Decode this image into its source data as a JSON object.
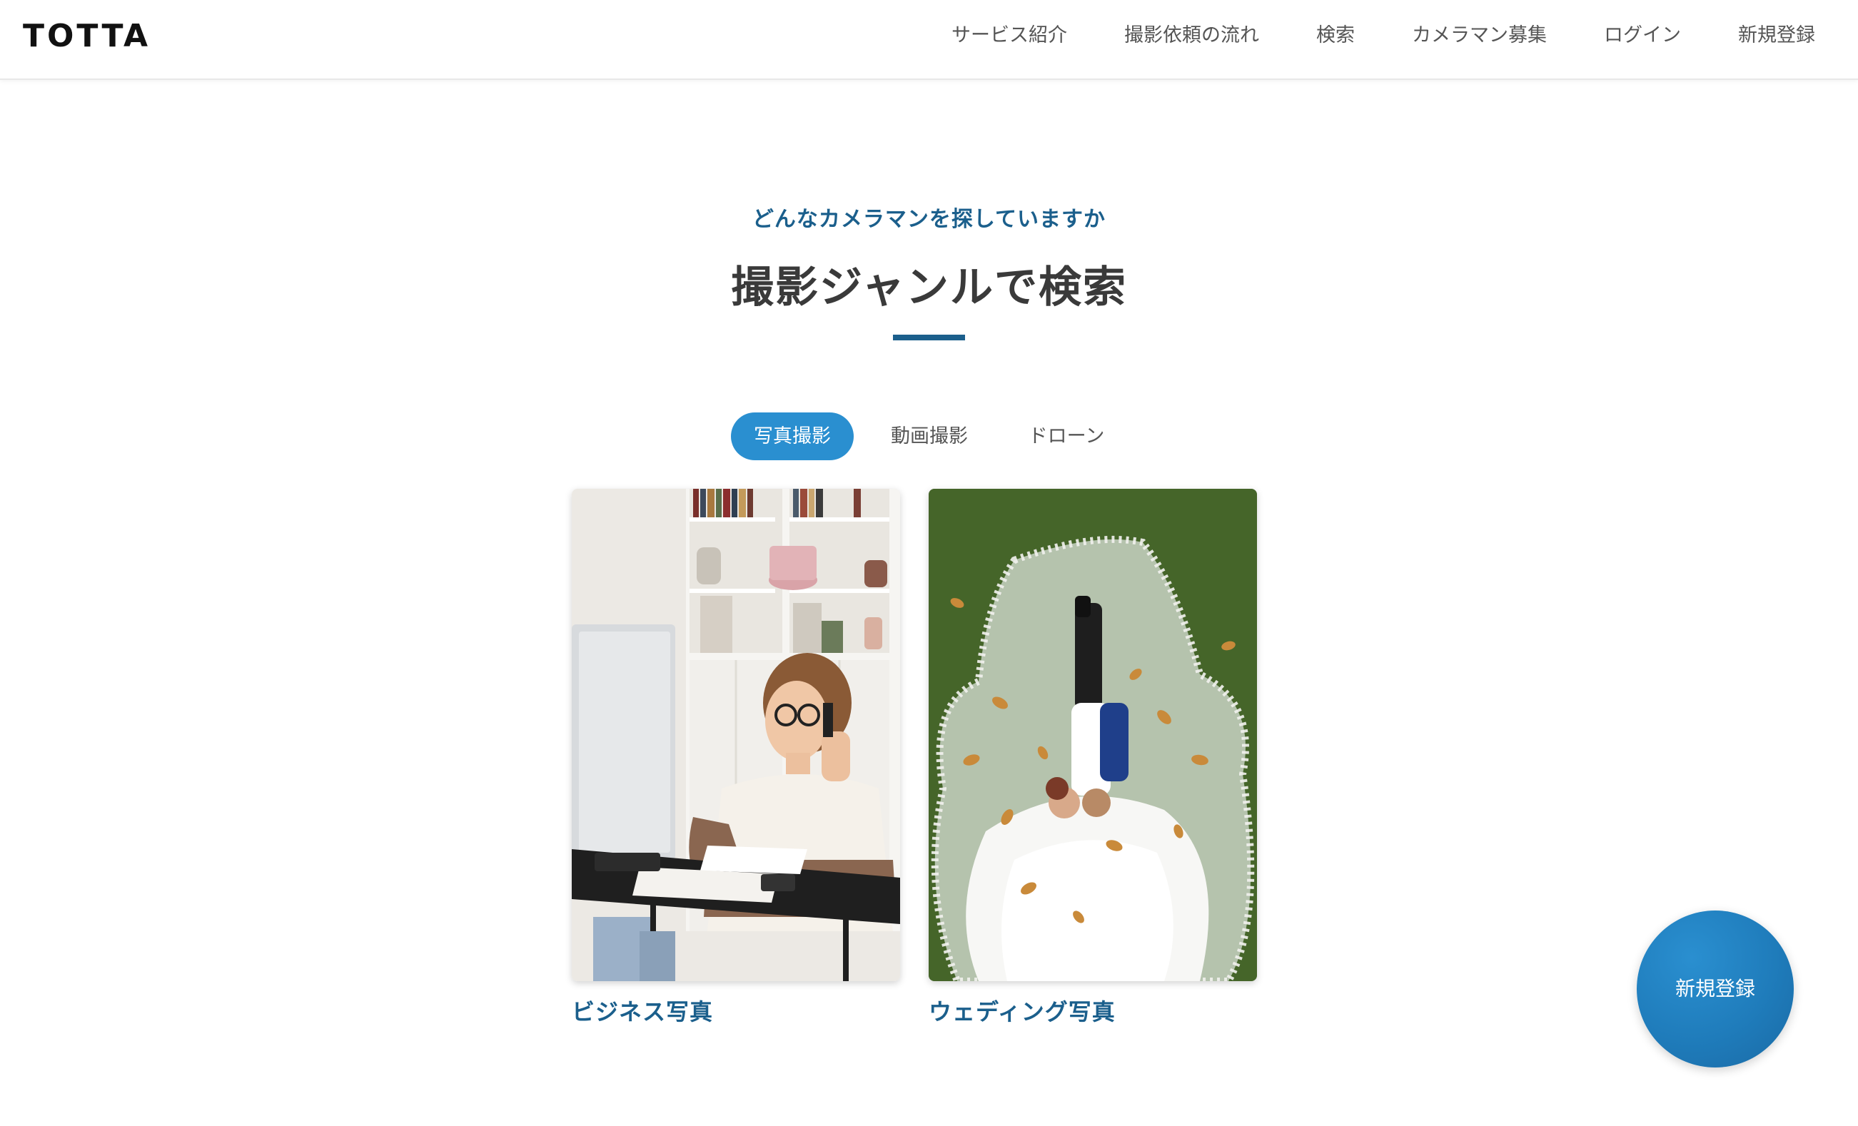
{
  "header": {
    "logo": "TOTTA",
    "nav": [
      "サービス紹介",
      "撮影依頼の流れ",
      "検索",
      "カメラマン募集",
      "ログイン",
      "新規登録"
    ]
  },
  "hero": {
    "subtitle": "どんなカメラマンを探していますか",
    "title": "撮影ジャンルで検索"
  },
  "tabs": [
    {
      "label": "写真撮影",
      "active": true
    },
    {
      "label": "動画撮影",
      "active": false
    },
    {
      "label": "ドローン",
      "active": false
    }
  ],
  "cards": [
    {
      "label": "ビジネス写真",
      "image": "business-woman-at-desk-photo"
    },
    {
      "label": "ウェディング写真",
      "image": "wedding-couple-on-grass-photo"
    }
  ],
  "fab": {
    "label": "新規登録"
  },
  "colors": {
    "accent": "#1b5f8c",
    "tab_active": "#2a8fd0",
    "text": "#333333"
  }
}
